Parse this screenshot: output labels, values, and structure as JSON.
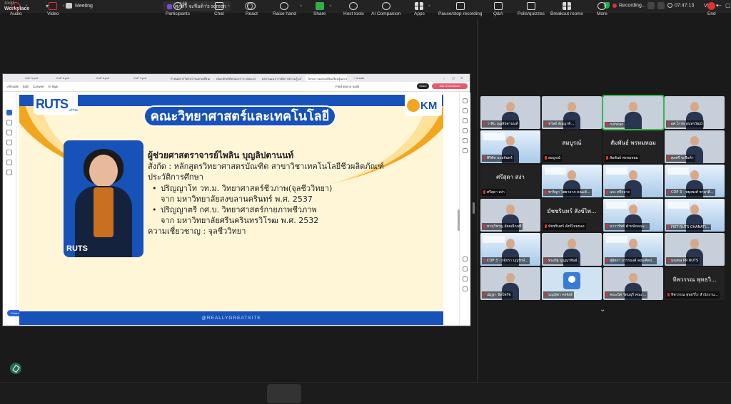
{
  "topbar": {
    "brand_line1": "zoom",
    "brand_line2": "Workplace",
    "meeting_label": "Meeting",
    "share_tab_label": "ศุภศรี จะจือด้า's screen",
    "recording_label": "Recording...",
    "time": "07:47:13",
    "view_label": "View"
  },
  "browser": {
    "tabs": [
      "CoP 1.pdf",
      "CoP 2.pdf",
      "CoP 3.pdf",
      "CoP 4.pdf",
      "กำหนดการโครงการแลกเปลี่ยนเรียน...",
      "คณะอักษรศิลปและการ 2566-2567...",
      "ผลงานแนวการจัดการความรู้ 2566 (1...",
      "โครงการแลกเปลี่ยนเรียนรู้และประชุม...",
      "+ Create"
    ],
    "toolbar_items": [
      "All tools",
      "Edit",
      "Convert",
      "E-Sign"
    ],
    "find_label": "Find text or tools",
    "share_label": "Share",
    "ai_label": "Ask AI Assistant",
    "free_trial": "Free trial"
  },
  "slide": {
    "logo_text": "RUTS",
    "logo_tag": "ศรีวิชัย",
    "km_text": "KM",
    "title": "คณะวิทยาศาสตร์และเทคโนโลยี",
    "photo_logo": "RUTS",
    "name": "ผู้ช่วยศาสตราจารย์ไพลิน  บุญลิปตานนท์",
    "affiliation": "สังกัด          : หลักสูตรวิทยาศาสตรบัณฑิต สาขาวิชาเทคโนโลยีชีวผลิตภัณฑ์",
    "education_heading": "ประวัติการศึกษา",
    "edu1": "ปริญญาโท วท.ม. วิทยาศาสตร์ชีวภาพ(จุลชีววิทยา)",
    "edu1_sub": "จาก มหาวิทยาลัยสงขลานครินทร์ พ.ศ. 2537",
    "edu2": "ปริญญาตรี กศ.บ. วิทยาศาสตร์กายภาพชีวภาพ",
    "edu2_sub": "จาก มหาวิทยาลัยศรีนครินทรวิโรฒ  พ.ศ. 2532",
    "expertise": "ความเชี่ยวชาญ   : จุลชีววิทยา",
    "footer": "@REALLYGREATSITE"
  },
  "gallery": {
    "tiles": [
      {
        "caption": "วาสิน บุญลิปตานนท์",
        "big": "",
        "type": "cam"
      },
      {
        "caption": "ชวัลย์ ธัญญาดิ...",
        "big": "",
        "type": "cam"
      },
      {
        "caption": "ruthkan",
        "big": "",
        "type": "cam",
        "active": true
      },
      {
        "caption": "ผศ.ไกรพ สุนทรวัฒน์",
        "big": "",
        "type": "cam"
      },
      {
        "caption": "ศิริพัช นวลจันทร์",
        "big": "",
        "type": "bg"
      },
      {
        "caption": "สมบูรณ์",
        "big": "สมบูรณ์",
        "type": "dark"
      },
      {
        "caption": "สัมพันธ์ พรหมหอม",
        "big": "สัมพันธ์ พรหมหอม",
        "type": "dark"
      },
      {
        "caption": "ศุภศรี จะจือด้า",
        "big": "",
        "type": "cam"
      },
      {
        "caption": "ศรีสุดา สง่า",
        "big": "ศรีสุดา สง่า",
        "type": "dark"
      },
      {
        "caption": "ชาริญา โพธาลาภ คณะสั...",
        "big": "",
        "type": "bg"
      },
      {
        "caption": "แกะ ศรีกลาง",
        "big": "",
        "type": "bg"
      },
      {
        "caption": "COP 3 - พยุงพงศ์ ชามาสิ...",
        "big": "",
        "type": "bg"
      },
      {
        "caption": "ทวนวิชาญ อัตมณีกนที",
        "big": "",
        "type": "cam"
      },
      {
        "caption": "มัชชรินทร์ สังข์ไหมทอง",
        "big": "มัชชรินทร์ สังข์ไพ...",
        "type": "dark"
      },
      {
        "caption": "นาวารัชต์ ตำหนักคณะ...",
        "big": "",
        "type": "bg"
      },
      {
        "caption": "FIET-RUTS CHANATI...",
        "big": "",
        "type": "bg"
      },
      {
        "caption": "COP 3 - กลีภรา บุญรักษ์...",
        "big": "",
        "type": "bg"
      },
      {
        "caption": "ทนงรัฐ บุญญาพันธ์",
        "big": "",
        "type": "cam"
      },
      {
        "caption": "สุมิตรา ภารรนงค์ คณะศิลป...",
        "big": "",
        "type": "bg"
      },
      {
        "caption": "มณฑล PR RUTS",
        "big": "",
        "type": "cam"
      },
      {
        "caption": "ณัฏฐา นิลไพรัช",
        "big": "",
        "type": "cam"
      },
      {
        "caption": "บุญญิตา คงจังษ์",
        "big": "",
        "type": "avatar"
      },
      {
        "caption": "คณะนิศ รัตนบุรี คณะ...",
        "big": "",
        "type": "cam"
      },
      {
        "caption": "ทิพวรรณ พุทธวิไร สำนักงาน...",
        "big": "ทิพวรรณ พุทธวิ...",
        "type": "dark"
      }
    ]
  },
  "bottombar": {
    "audio": "Audio",
    "video": "Video",
    "participants": "Participants",
    "participants_count": "169",
    "chat": "Chat",
    "react": "React",
    "raise_hand": "Raise hand",
    "share": "Share",
    "host_tools": "Host tools",
    "ai_companion": "AI Companion",
    "apps": "Apps",
    "pause_stop": "Pause/stop recording",
    "qa": "Q&A",
    "polls": "Polls/quizzes",
    "breakout": "Breakout rooms",
    "more": "More",
    "end": "End"
  }
}
